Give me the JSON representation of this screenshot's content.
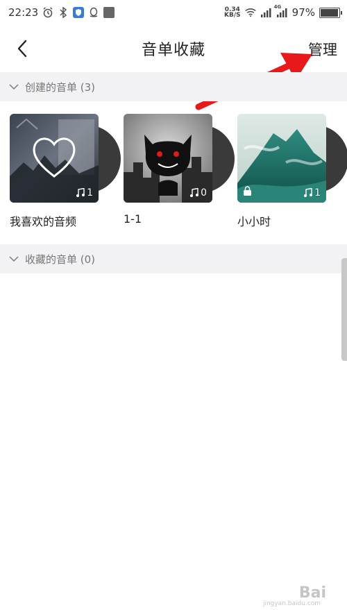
{
  "status_bar": {
    "time": "22:23",
    "net_speed_value": "0.34",
    "net_speed_unit": "KB/S",
    "signal_label": "4G",
    "battery": "97%",
    "battery_level": 0.97
  },
  "header": {
    "title": "音单收藏",
    "manage_label": "管理"
  },
  "created_section": {
    "label": "创建的音单 (3)",
    "playlists": [
      {
        "name": "我喜欢的音频",
        "count": "1",
        "locked": false
      },
      {
        "name": "1-1",
        "count": "0",
        "locked": false
      },
      {
        "name": "小小时",
        "count": "1",
        "locked": true
      }
    ]
  },
  "collected_section": {
    "label": "收藏的音单 (0)"
  },
  "watermark": {
    "text": "Bai",
    "sub": "jingyan.baidu.com"
  },
  "colors": {
    "annotation_arrow": "#e8191b",
    "section_bg": "#f2f2f4"
  }
}
